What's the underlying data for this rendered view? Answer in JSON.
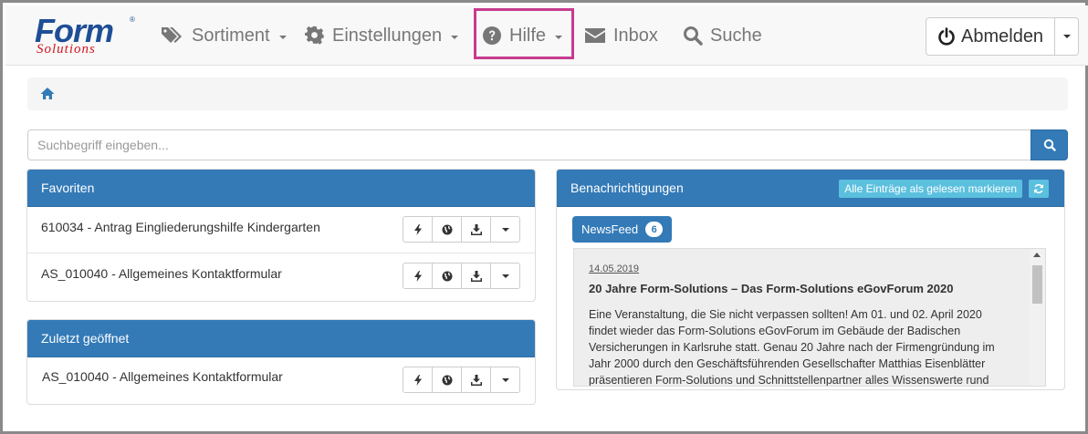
{
  "navbar": {
    "logo": {
      "main": "Form",
      "sub": "Solutions",
      "reg": "®"
    },
    "items": [
      {
        "label": "Sortiment",
        "icon": "tags-icon",
        "dropdown": true
      },
      {
        "label": "Einstellungen",
        "icon": "gear-icon",
        "dropdown": true
      },
      {
        "label": "Hilfe",
        "icon": "question-circle-icon",
        "dropdown": true
      },
      {
        "label": "Inbox",
        "icon": "envelope-icon",
        "dropdown": false
      },
      {
        "label": "Suche",
        "icon": "search-icon",
        "dropdown": false
      }
    ],
    "logout_label": "Abmelden"
  },
  "breadcrumb": {
    "icon": "home-icon"
  },
  "search": {
    "placeholder": "Suchbegriff eingeben...",
    "value": ""
  },
  "favorites": {
    "title": "Favoriten",
    "items": [
      {
        "label": "610034 - Antrag Eingliederungshilfe Kindergarten"
      },
      {
        "label": "AS_010040 - Allgemeines Kontaktformular"
      }
    ]
  },
  "recent": {
    "title": "Zuletzt geöffnet",
    "items": [
      {
        "label": "AS_010040 - Allgemeines Kontaktformular"
      }
    ]
  },
  "notifications": {
    "title": "Benachrichtigungen",
    "mark_all_read_label": "Alle Einträge als gelesen markieren",
    "newsfeed_label": "NewsFeed",
    "newsfeed_count": "6",
    "news": {
      "date": "14.05.2019",
      "title": "20 Jahre Form-Solutions – Das Form-Solutions eGovForum 2020",
      "body": "Eine Veranstaltung, die Sie nicht verpassen solltenǃ Am 01. und 02. April 2020 findet wieder das Form-Solutions eGovForum im Gebäude der Badischen Versicherungen in Karlsruhe statt. Genau 20 Jahre nach der Firmengründung im Jahr 2000 durch den Geschäftsführenden Gesellschafter Matthias Eisenblätter präsentieren Form-Solutions und Schnittstellenpartner alles Wissenswerte rund"
    }
  },
  "colors": {
    "primary": "#337ab7",
    "info": "#5bc0de",
    "highlight": "#c73b8f",
    "logo_blue": "#1f4e96",
    "logo_red": "#d3141e"
  }
}
